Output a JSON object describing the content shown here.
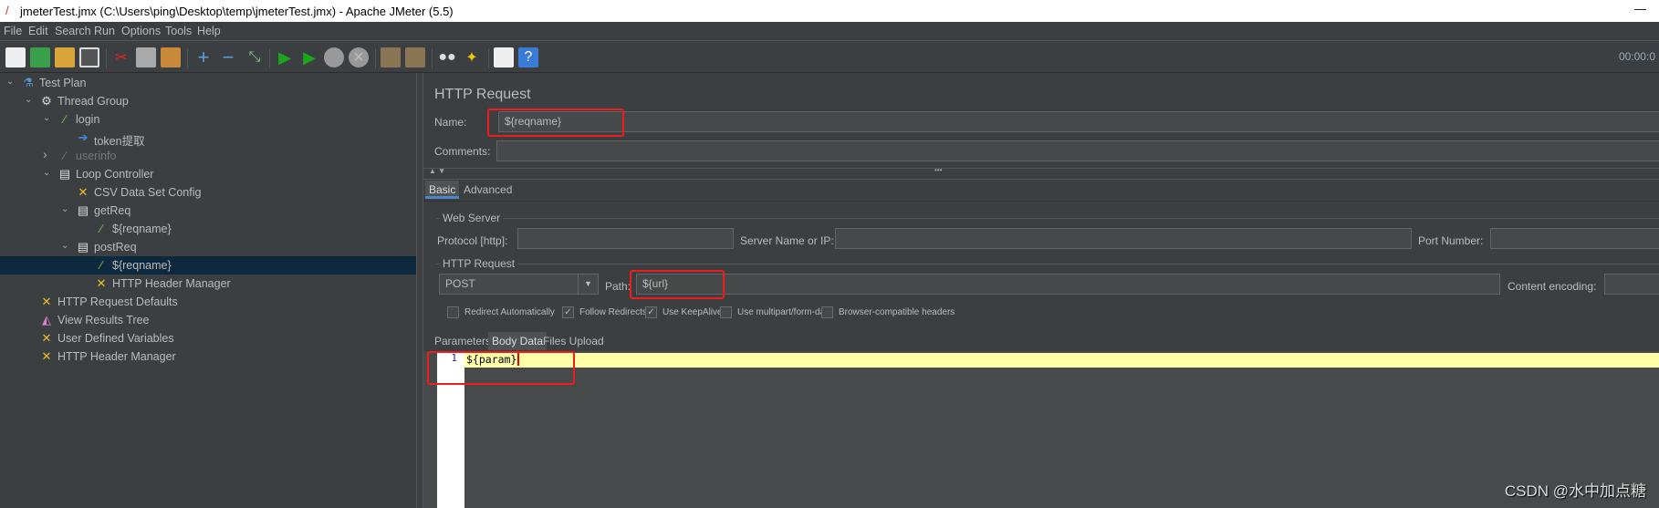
{
  "window": {
    "title": "jmeterTest.jmx (C:\\Users\\ping\\Desktop\\temp\\jmeterTest.jmx) - Apache JMeter (5.5)",
    "minimize": "—"
  },
  "menu": [
    {
      "label": "File"
    },
    {
      "label": "Edit"
    },
    {
      "label": "Search"
    },
    {
      "label": "Run"
    },
    {
      "label": "Options"
    },
    {
      "label": "Tools"
    },
    {
      "label": "Help"
    }
  ],
  "toolbar": {
    "timer": "00:00:0",
    "buttons": [
      "new",
      "templates",
      "open",
      "save",
      "cut",
      "copy",
      "paste",
      "expand",
      "collapse",
      "toggle",
      "start",
      "start-no-pauses",
      "stop",
      "shutdown",
      "clear",
      "clear-all",
      "search",
      "reset-search",
      "function-helper",
      "help"
    ]
  },
  "tree": [
    {
      "label": "Test Plan",
      "icon": "flask-icon",
      "expanded": true
    },
    {
      "label": "Thread Group",
      "icon": "gear-icon",
      "expanded": true
    },
    {
      "label": "login",
      "icon": "pipette-icon",
      "expanded": true
    },
    {
      "label": "token提取",
      "icon": "extractor-icon"
    },
    {
      "label": "userinfo",
      "icon": "pipette-icon",
      "expanded": false,
      "disabled": true
    },
    {
      "label": "Loop Controller",
      "icon": "controller-icon",
      "expanded": true
    },
    {
      "label": "CSV Data Set Config",
      "icon": "tools-icon"
    },
    {
      "label": "getReq",
      "icon": "controller-icon",
      "expanded": true
    },
    {
      "label": "${reqname}",
      "icon": "pipette-icon"
    },
    {
      "label": "postReq",
      "icon": "controller-icon",
      "expanded": true
    },
    {
      "label": "${reqname}",
      "icon": "pipette-icon",
      "selected": true
    },
    {
      "label": "HTTP Header Manager",
      "icon": "tools-icon"
    },
    {
      "label": "HTTP Request Defaults",
      "icon": "tools-icon"
    },
    {
      "label": "View Results Tree",
      "icon": "graph-icon"
    },
    {
      "label": "User Defined Variables",
      "icon": "tools-icon"
    },
    {
      "label": "HTTP Header Manager",
      "icon": "tools-icon"
    }
  ],
  "panel": {
    "title": "HTTP Request",
    "name_label": "Name:",
    "name_value": "${reqname}",
    "comments_label": "Comments:",
    "comments_value": "",
    "tabs": [
      "Basic",
      "Advanced"
    ],
    "web_server": {
      "legend": "Web Server",
      "protocol_label": "Protocol [http]:",
      "protocol_value": "",
      "server_label": "Server Name or IP:",
      "server_value": "",
      "port_label": "Port Number:",
      "port_value": ""
    },
    "http_request": {
      "legend": "HTTP Request",
      "method": "POST",
      "path_label": "Path:",
      "path_value": "${url}",
      "encoding_label": "Content encoding:",
      "encoding_value": ""
    },
    "checkboxes": [
      {
        "label": "Redirect Automatically",
        "checked": false
      },
      {
        "label": "Follow Redirects",
        "checked": true
      },
      {
        "label": "Use KeepAlive",
        "checked": true
      },
      {
        "label": "Use multipart/form-data",
        "checked": false
      },
      {
        "label": "Browser-compatible headers",
        "checked": false
      }
    ],
    "subtabs": [
      "Parameters",
      "Body Data",
      "Files Upload"
    ],
    "active_subtab": "Body Data",
    "body": {
      "line_number": "1",
      "line": "${param}"
    }
  },
  "watermark": "CSDN @水中加点糖",
  "colors": {
    "bg": "#3c3f41",
    "field": "#45494a",
    "selected": "#0d293e",
    "highlight": "#ffffa8",
    "annotation": "#f01c1c"
  }
}
